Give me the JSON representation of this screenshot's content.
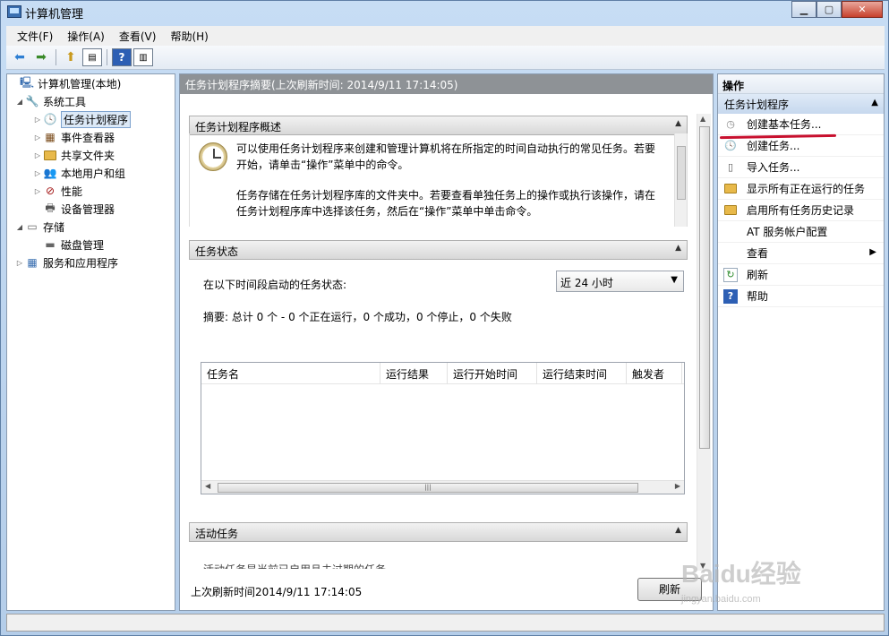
{
  "window": {
    "title": "计算机管理"
  },
  "menubar": [
    "文件(F)",
    "操作(A)",
    "查看(V)",
    "帮助(H)"
  ],
  "tree": [
    {
      "label": "计算机管理(本地)",
      "icon": "computer-management-icon",
      "indent": 0,
      "twisty": ""
    },
    {
      "label": "系统工具",
      "icon": "tools-icon",
      "indent": 1,
      "twisty": "◢"
    },
    {
      "label": "任务计划程序",
      "icon": "clock-icon",
      "indent": 2,
      "twisty": "▷",
      "selected": true
    },
    {
      "label": "事件查看器",
      "icon": "event-viewer-icon",
      "indent": 2,
      "twisty": "▷"
    },
    {
      "label": "共享文件夹",
      "icon": "shared-folder-icon",
      "indent": 2,
      "twisty": "▷"
    },
    {
      "label": "本地用户和组",
      "icon": "users-icon",
      "indent": 2,
      "twisty": "▷"
    },
    {
      "label": "性能",
      "icon": "performance-icon",
      "indent": 2,
      "twisty": "▷"
    },
    {
      "label": "设备管理器",
      "icon": "device-manager-icon",
      "indent": 2,
      "twisty": ""
    },
    {
      "label": "存储",
      "icon": "storage-icon",
      "indent": 1,
      "twisty": "◢"
    },
    {
      "label": "磁盘管理",
      "icon": "disk-icon",
      "indent": 2,
      "twisty": ""
    },
    {
      "label": "服务和应用程序",
      "icon": "services-icon",
      "indent": 1,
      "twisty": "▷"
    }
  ],
  "center": {
    "header": "任务计划程序摘要(上次刷新时间: 2014/9/11 17:14:05)",
    "overview_title": "任务计划程序概述",
    "overview_p1_line1": "可以使用任务计划程序来创建和管理计算机将在所指定的时间自动执行的常见任务。若要",
    "overview_p1_line2": "开始，请单击“操作”菜单中的命令。",
    "overview_p2_line1": "任务存储在任务计划程序库的文件夹中。若要查看单独任务上的操作或执行该操作，请在",
    "overview_p2_line2": "任务计划程序库中选择该任务，然后在“操作”菜单中单击命令。",
    "status_title": "任务状态",
    "status_label": "在以下时间段启动的任务状态:",
    "period_selected": "近 24 小时",
    "summary": "摘要: 总计 0 个 - 0 个正在运行，0 个成功，0 个停止，0 个失败",
    "columns": [
      "任务名",
      "运行结果",
      "运行开始时间",
      "运行结束时间",
      "触发者"
    ],
    "active_title": "活动任务",
    "active_partial": "活动任务是当前已启用且未过期的任务。",
    "footer_text": "上次刷新时间2014/9/11 17:14:05",
    "refresh_label": "刷新"
  },
  "actions": {
    "header": "操作",
    "group": "任务计划程序",
    "items": [
      {
        "label": "创建基本任务...",
        "icon": "basic-task-icon"
      },
      {
        "label": "创建任务...",
        "icon": "create-task-icon"
      },
      {
        "label": "导入任务...",
        "icon": "import-icon"
      },
      {
        "label": "显示所有正在运行的任务",
        "icon": "folder-icon"
      },
      {
        "label": "启用所有任务历史记录",
        "icon": "folder-icon"
      },
      {
        "label": "AT 服务帐户配置",
        "icon": ""
      },
      {
        "label": "查看",
        "icon": "",
        "submenu": true
      },
      {
        "label": "刷新",
        "icon": "refresh-icon"
      },
      {
        "label": "帮助",
        "icon": "help-icon"
      }
    ]
  },
  "watermark": {
    "main": "Baidu经验",
    "sub": "jingyan.baidu.com"
  }
}
